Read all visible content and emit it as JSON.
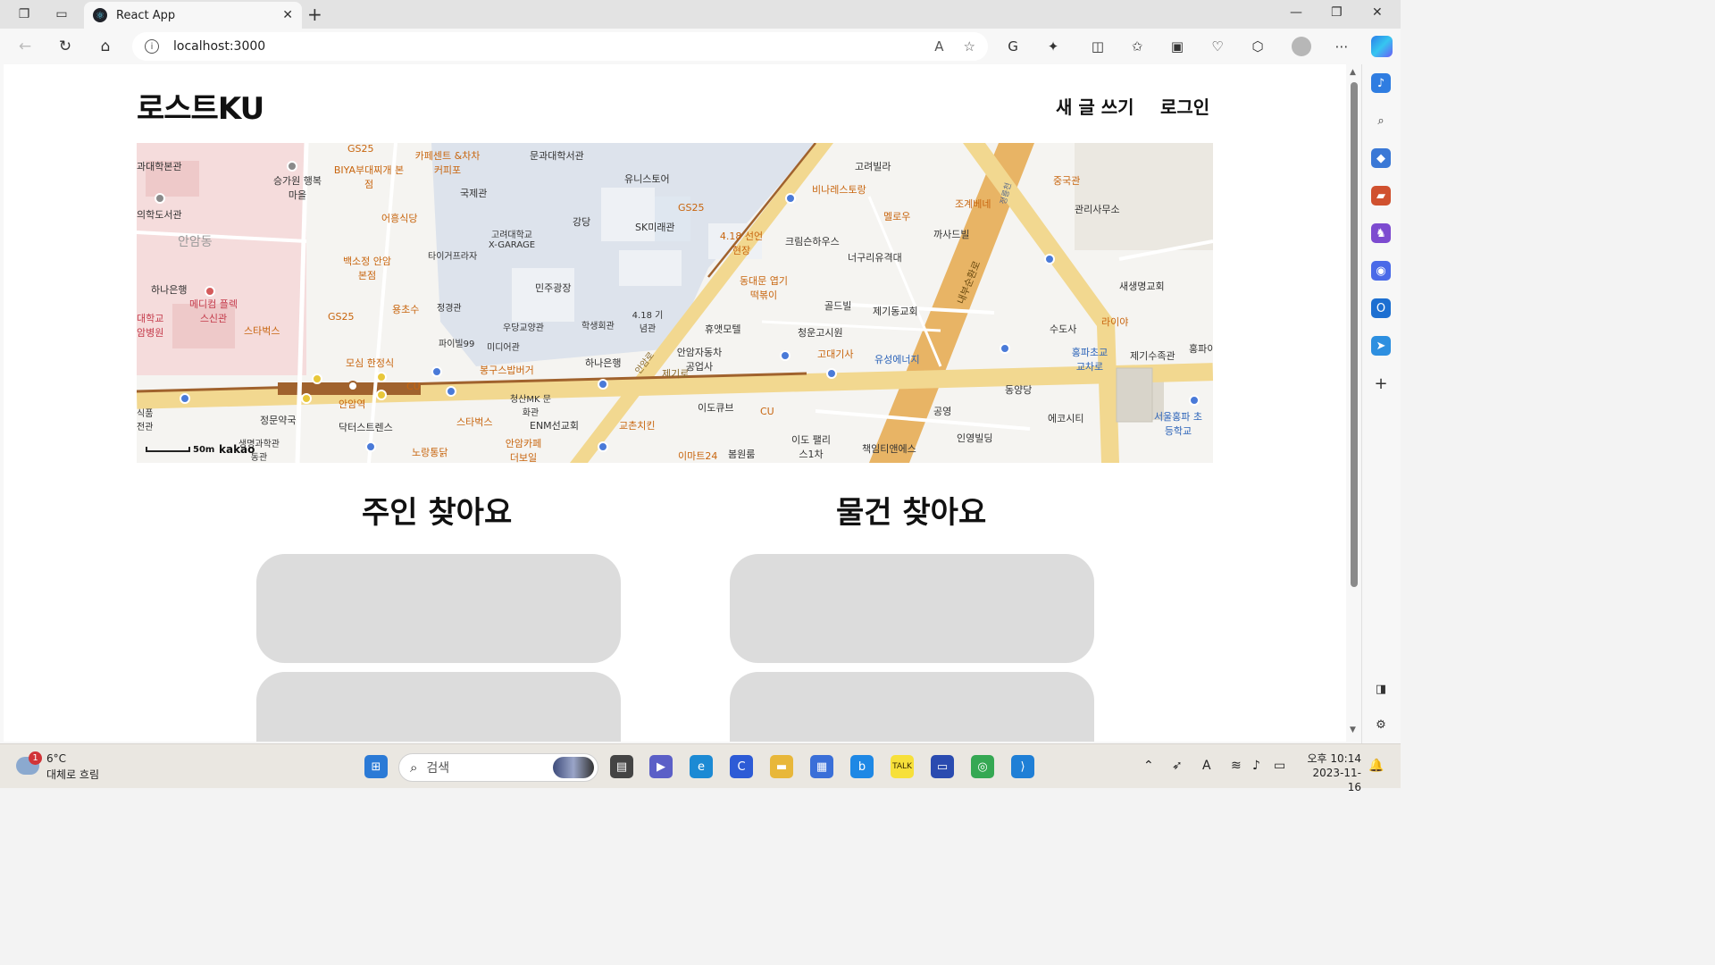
{
  "browser": {
    "tab_title": "React App",
    "url": "localhost:3000"
  },
  "site": {
    "logo": "로스트KU",
    "nav": {
      "write": "새 글 쓰기",
      "login": "로그인"
    }
  },
  "map": {
    "attribution": "kakao",
    "scale": "50m",
    "labels": {
      "l1": "과대학본관",
      "l2": "승가원 행복마을",
      "l3": "BIYA부대찌개 본점",
      "l4": "카페센트 &차차커피포",
      "l5": "문과대학서관",
      "l6": "국제관",
      "l7": "의학도서관",
      "l8": "어흥식당",
      "l9": "유니스토어",
      "l10": "GS25",
      "l11": "SK미래관",
      "l12": "강당",
      "l13": "고려대학교 X-GARAGE",
      "l14": "안암동",
      "l15": "타이거프라자",
      "l16": "백소정 안암본점",
      "l17": "4.18 선언현장",
      "l18": "고려빌라",
      "l19": "비나레스토랑",
      "l20": "멜로우",
      "l21": "조계베네",
      "l22": "중국관",
      "l23": "관리사무소",
      "l24": "크림슨하우스",
      "l25": "너구리유격대",
      "l26": "까사드빌",
      "l27": "하나은행",
      "l28": "메디컴 플렉스신관",
      "l29": "민주광장",
      "l30": "대학교 암병원",
      "l31": "GS25",
      "l32": "용초수",
      "l33": "정경관",
      "l34": "스타벅스",
      "l35": "우당교양관",
      "l36": "학생회관",
      "l37": "4.18 기념관",
      "l38": "동대문 엽기떡볶이",
      "l39": "새생명교회",
      "l40": "골드빌",
      "l41": "제기동교회",
      "l42": "라이야",
      "l43": "휴앳모텔",
      "l44": "청운고시원",
      "l45": "수도사",
      "l46": "파이빌99",
      "l47": "미디어관",
      "l48": "모심 한정식",
      "l49": "봉구스밥버거",
      "l50": "하나은행",
      "l51": "안암자동차 공업사",
      "l52": "고대기사",
      "l53": "유성에너지",
      "l54": "홍파초교 교차로",
      "l55": "제기수족관",
      "l56": "제기로",
      "l57": "동양당",
      "l58": "에코시티",
      "l59": "서울홍파 초등학교",
      "l60": "청산MK 문화관",
      "l61": "ENM선교회",
      "l62": "이도큐브",
      "l63": "CU",
      "l64": "공영",
      "l65": "안암역",
      "l66": "CU",
      "l67": "정문약국",
      "l68": "닥터스트렌스",
      "l69": "스타벅스",
      "l70": "교촌치킨",
      "l71": "인영빌딩",
      "l72": "이도 팰리스1차",
      "l73": "책임티앤에스",
      "l74": "안암카페 더보일",
      "l75": "노랑통닭",
      "l76": "생명과학관 동관",
      "l77": "이마트24",
      "l78": "봄원룸",
      "l79": "홍파이",
      "l80": "식품 전관",
      "l81": "내부순환로",
      "l82": "정릉천",
      "l83": "안암로",
      "l84": "GS25"
    }
  },
  "sections": {
    "owner_title": "주인 찾아요",
    "item_title": "물건 찾아요"
  },
  "taskbar": {
    "temp": "6°C",
    "weather": "대체로 흐림",
    "badge": "1",
    "search_placeholder": "검색",
    "time": "오후 10:14",
    "date": "2023-11-16"
  },
  "colors": {
    "card": "#dcdcdc",
    "main_road": "#f2d890",
    "arterial": "#e8b465",
    "subway": "#a0622d"
  }
}
